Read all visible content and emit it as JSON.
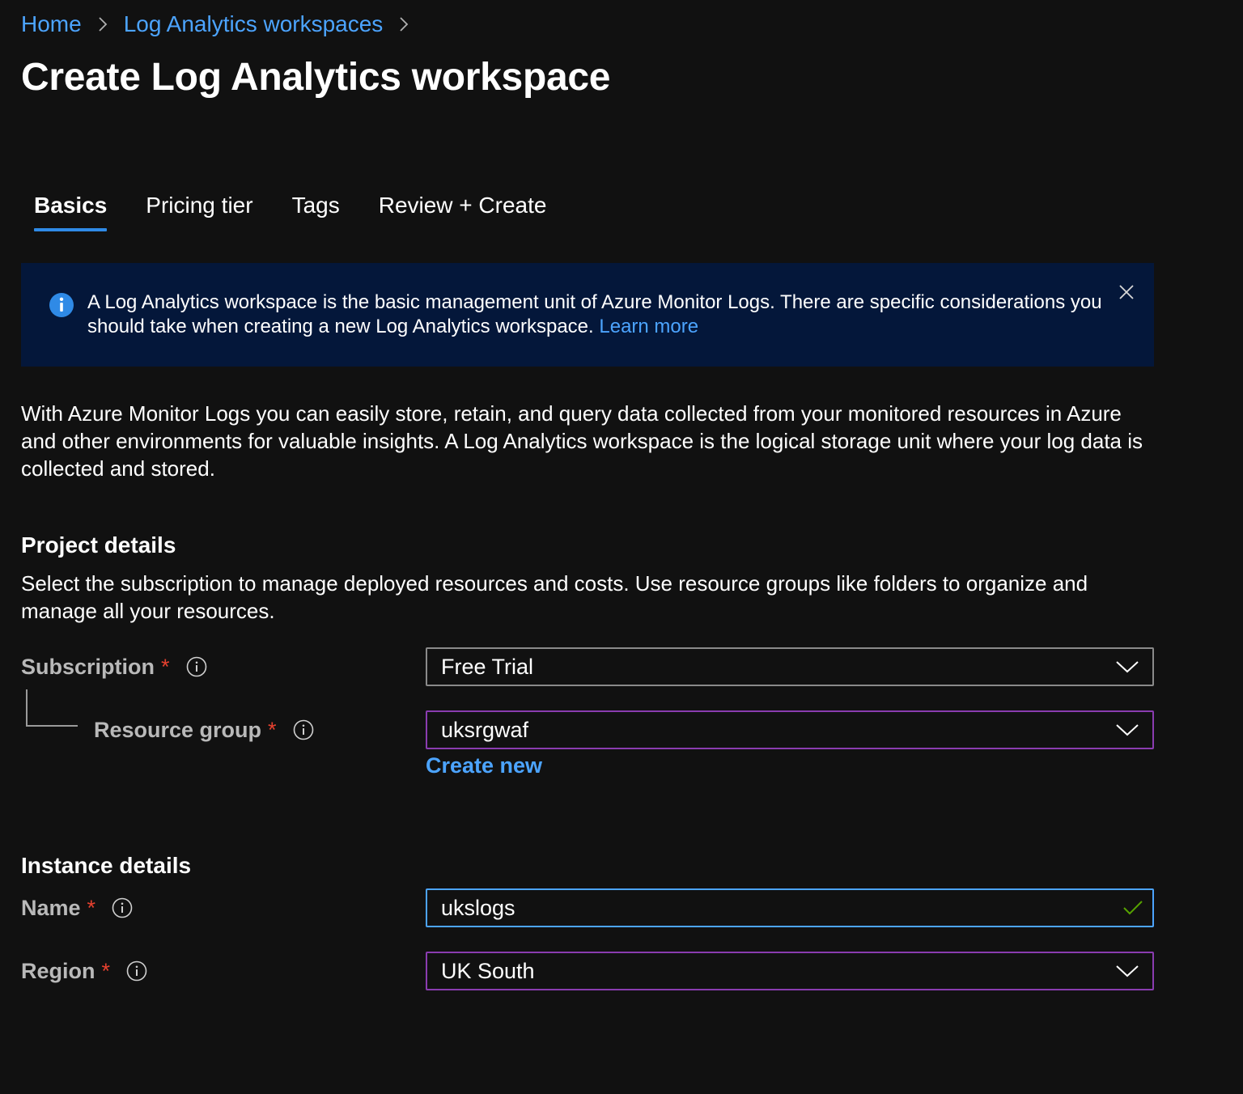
{
  "breadcrumb": {
    "items": [
      "Home",
      "Log Analytics workspaces"
    ]
  },
  "page": {
    "title": "Create Log Analytics workspace"
  },
  "tabs": [
    {
      "label": "Basics",
      "active": true
    },
    {
      "label": "Pricing tier",
      "active": false
    },
    {
      "label": "Tags",
      "active": false
    },
    {
      "label": "Review + Create",
      "active": false
    }
  ],
  "info_banner": {
    "text": "A Log Analytics workspace is the basic management unit of Azure Monitor Logs. There are specific considerations you should take when creating a new Log Analytics workspace. ",
    "link": "Learn more",
    "icon": "info-icon"
  },
  "description": "With Azure Monitor Logs you can easily store, retain, and query data collected from your monitored resources in Azure and other environments for valuable insights. A Log Analytics workspace is the logical storage unit where your log data is collected and stored.",
  "project_details": {
    "heading": "Project details",
    "description": "Select the subscription to manage deployed resources and costs. Use resource groups like folders to organize and manage all your resources.",
    "subscription": {
      "label": "Subscription",
      "required": "*",
      "value": "Free Trial"
    },
    "resource_group": {
      "label": "Resource group",
      "required": "*",
      "value": "uksrgwaf",
      "create_new": "Create new"
    }
  },
  "instance_details": {
    "heading": "Instance details",
    "name": {
      "label": "Name",
      "required": "*",
      "value": "ukslogs",
      "valid": true
    },
    "region": {
      "label": "Region",
      "required": "*",
      "value": "UK South"
    }
  },
  "colors": {
    "background": "#111111",
    "link": "#4ca4ff",
    "accent": "#2f8ae6",
    "banner": "#04173a",
    "required": "#e6412f",
    "focus_purple": "#8a3cb0",
    "valid_green": "#57a300"
  }
}
